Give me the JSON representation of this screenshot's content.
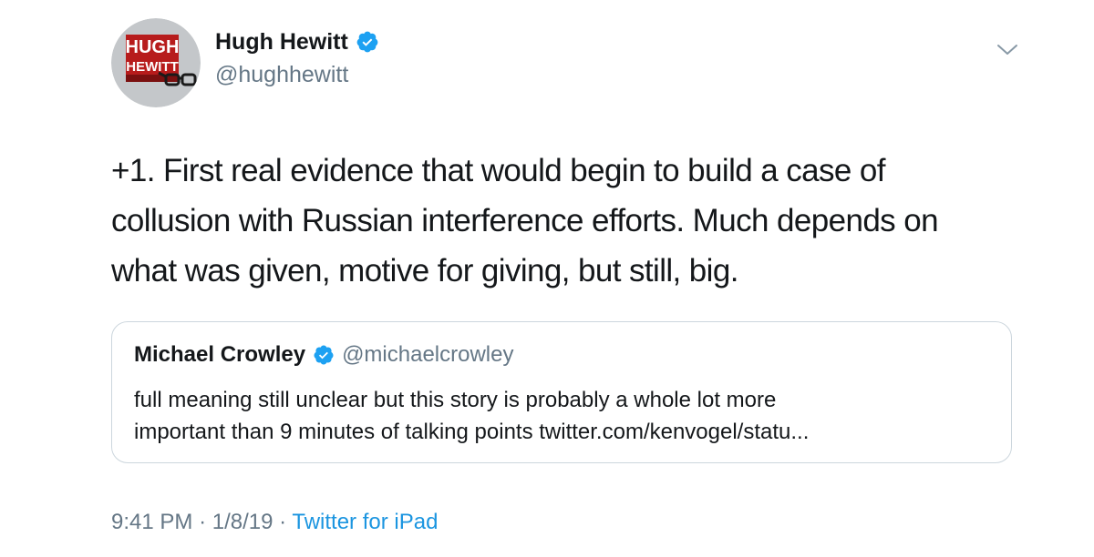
{
  "author": {
    "display_name": "Hugh Hewitt",
    "handle": "@hughhewitt",
    "avatar": {
      "logo_text_line1": "HUGH",
      "logo_text_line2": "HEWITT",
      "icon": "hugh-hewitt-logo"
    },
    "verified": true
  },
  "tweet": {
    "text_lines": [
      "+1. First real evidence that would begin to build a case of",
      "collusion with Russian interference efforts. Much depends on",
      "what was given, motive for giving, but still, big."
    ]
  },
  "quoted_tweet": {
    "display_name": "Michael Crowley",
    "handle": "@michaelcrowley",
    "verified": true,
    "text_lines": [
      "full meaning still unclear but this story is probably a whole lot more",
      "important than 9 minutes of talking points twitter.com/kenvogel/statu..."
    ]
  },
  "meta": {
    "time": "9:41 PM",
    "separator": "·",
    "date": "1/8/19",
    "source": "Twitter for iPad"
  },
  "colors": {
    "text": "#14171a",
    "secondary": "#657786",
    "link": "#1b95e0",
    "verified": "#1da1f2",
    "border": "#ccd6dd"
  },
  "icons": {
    "verified": "verified-badge-icon",
    "menu": "chevron-down-icon"
  }
}
